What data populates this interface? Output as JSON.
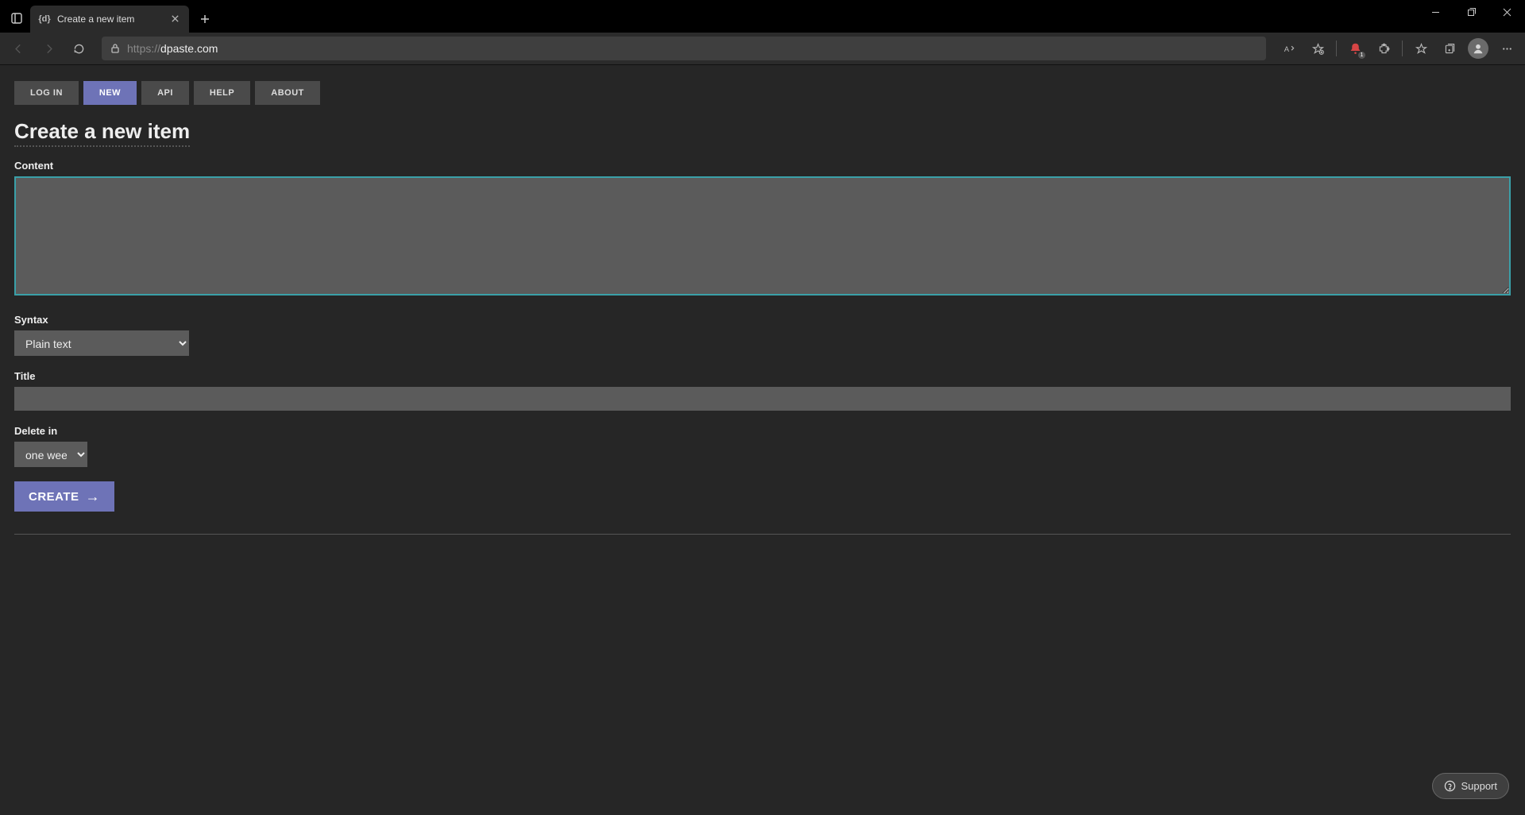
{
  "browser": {
    "tab_title": "Create a new item",
    "url_protocol": "https://",
    "url_domain": "dpaste.com",
    "alert_badge": "1"
  },
  "nav": {
    "items": [
      {
        "label": "LOG IN"
      },
      {
        "label": "NEW"
      },
      {
        "label": "API"
      },
      {
        "label": "HELP"
      },
      {
        "label": "ABOUT"
      }
    ]
  },
  "page": {
    "heading": "Create a new item",
    "labels": {
      "content": "Content",
      "syntax": "Syntax",
      "title": "Title",
      "delete_in": "Delete in"
    },
    "fields": {
      "content_value": "",
      "syntax_selected": "Plain text",
      "title_value": "",
      "delete_selected": "one week"
    },
    "create_button": "CREATE"
  },
  "support": {
    "label": "Support"
  }
}
